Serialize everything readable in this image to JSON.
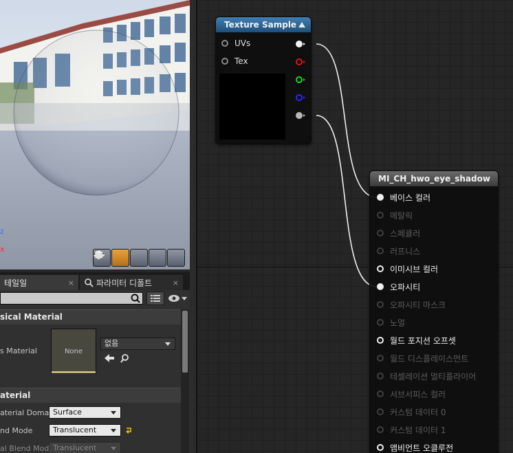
{
  "viewport": {
    "axis_z_label": "z",
    "axis_x_label": "x",
    "toolbar": [
      {
        "name": "cylinder-preview-button",
        "icon": "cylinder-icon",
        "active": false
      },
      {
        "name": "sphere-preview-button",
        "icon": "sphere-icon",
        "active": true
      },
      {
        "name": "plane-preview-button",
        "icon": "plane-icon",
        "active": false
      },
      {
        "name": "cube-preview-button",
        "icon": "cube-icon",
        "active": false
      },
      {
        "name": "custom-mesh-preview-button",
        "icon": "teapot-icon",
        "active": false
      }
    ]
  },
  "details": {
    "tabs": [
      {
        "label": "테일일",
        "close": "×"
      },
      {
        "label": "파라미터 디폴트",
        "close": "×"
      }
    ],
    "search": {
      "value": ""
    },
    "sections": {
      "physical": "sical Material",
      "material": "aterial"
    },
    "phys_material": {
      "label": "s Material",
      "thumb_text": "None",
      "value": "없음"
    },
    "props": [
      {
        "label": "aterial Domain",
        "value": "Surface"
      },
      {
        "label": "nd Mode",
        "value": "Translucent"
      },
      {
        "label": "al Blend Mode",
        "value": "Translucent"
      }
    ]
  },
  "graph": {
    "texture_node": {
      "title": "Texture Sample",
      "inputs": [
        "UVs",
        "Tex"
      ],
      "outputs": [
        {
          "name": "rgb-output-pin",
          "color": "#f2f2f2",
          "filled": true
        },
        {
          "name": "red-output-pin",
          "color": "#e01414",
          "filled": false
        },
        {
          "name": "green-output-pin",
          "color": "#1ed41e",
          "filled": false
        },
        {
          "name": "blue-output-pin",
          "color": "#1a1aff",
          "filled": false
        },
        {
          "name": "alpha-output-pin",
          "color": "#b8b8b8",
          "filled": true
        }
      ]
    },
    "material_node": {
      "title": "MI_CH_hwo_eye_shadow",
      "pins": [
        {
          "label": "베이스 컬러",
          "on": true,
          "connected": true
        },
        {
          "label": "메탈릭",
          "on": false
        },
        {
          "label": "스페큘러",
          "on": false
        },
        {
          "label": "러프니스",
          "on": false
        },
        {
          "label": "이미시브 컬러",
          "on": true,
          "connected": false
        },
        {
          "label": "오파시티",
          "on": true,
          "connected": true
        },
        {
          "label": "오파시티 마스크",
          "on": false
        },
        {
          "label": "노멀",
          "on": false
        },
        {
          "label": "월드 포지션 오프셋",
          "on": true,
          "connected": false
        },
        {
          "label": "월드 디스플레이스먼트",
          "on": false
        },
        {
          "label": "테셀레이션 멀티플라이어",
          "on": false
        },
        {
          "label": "서브서피스 컬러",
          "on": false
        },
        {
          "label": "커스텀 데이터 0",
          "on": false
        },
        {
          "label": "커스텀 데이터 1",
          "on": false
        },
        {
          "label": "앰비언트 오클루전",
          "on": true,
          "connected": false
        }
      ]
    }
  }
}
